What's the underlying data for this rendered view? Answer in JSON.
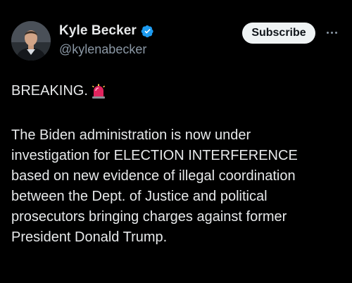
{
  "author": {
    "display_name": "Kyle Becker",
    "handle": "@kylenabecker",
    "verified": true,
    "avatar_icon": "person-avatar"
  },
  "actions": {
    "subscribe_label": "Subscribe",
    "more_icon": "ellipsis-horizontal-icon"
  },
  "post": {
    "headline": "BREAKING.",
    "headline_emoji": "police-siren-icon",
    "body_lines": [
      "The Biden administration is now under",
      "investigation for ELECTION INTERFERENCE",
      "based on new evidence of illegal coordination",
      "between the Dept. of Justice and political",
      "prosecutors bringing charges against former",
      "President Donald Trump."
    ]
  },
  "colors": {
    "background": "#000000",
    "primary_text": "#e7e9ea",
    "secondary_text": "#8b98a5",
    "verified_blue": "#1d9bf0",
    "button_bg": "#eff3f4",
    "siren_red": "#e0245e"
  }
}
